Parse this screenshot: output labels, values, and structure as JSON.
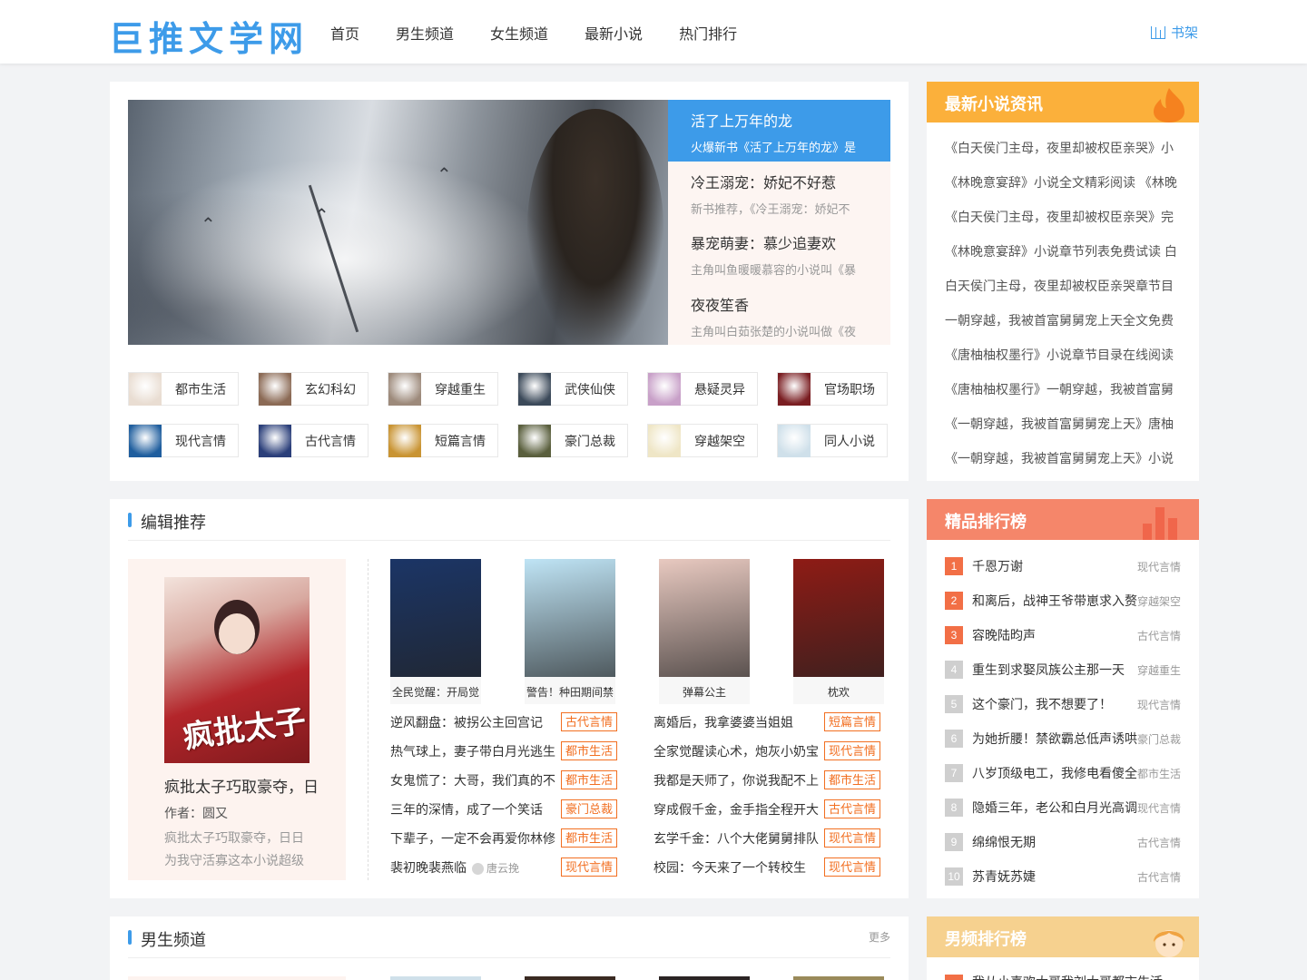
{
  "site": {
    "logo": "巨推文学网",
    "shelf": "书架"
  },
  "nav": [
    "首页",
    "男生频道",
    "女生频道",
    "最新小说",
    "热门排行"
  ],
  "slides": [
    {
      "title": "活了上万年的龙",
      "desc": "火爆新书《活了上万年的龙》是"
    },
    {
      "title": "冷王溺宠：娇妃不好惹",
      "desc": "新书推荐，《冷王溺宠：娇妃不"
    },
    {
      "title": "暴宠萌妻：慕少追妻欢",
      "desc": "主角叫鱼暖暖慕容的小说叫《暴"
    },
    {
      "title": "夜夜笙香",
      "desc": "主角叫白茹张楚的小说叫做《夜"
    }
  ],
  "categories": [
    {
      "label": "都市生活",
      "color": "#e9ddd2"
    },
    {
      "label": "玄幻科幻",
      "color": "#8b6a55"
    },
    {
      "label": "穿越重生",
      "color": "#9d8a7b"
    },
    {
      "label": "武侠仙侠",
      "color": "#3c4a5a"
    },
    {
      "label": "悬疑灵异",
      "color": "#c8a0c8"
    },
    {
      "label": "官场职场",
      "color": "#7a1e22"
    },
    {
      "label": "现代言情",
      "color": "#1f5e9e"
    },
    {
      "label": "古代言情",
      "color": "#2b3f7a"
    },
    {
      "label": "短篇言情",
      "color": "#c99433"
    },
    {
      "label": "豪门总裁",
      "color": "#5a5f3d"
    },
    {
      "label": "穿越架空",
      "color": "#efe6c6"
    },
    {
      "label": "同人小说",
      "color": "#cfe0ea"
    }
  ],
  "news": {
    "title": "最新小说资讯",
    "items": [
      "《白天侯门主母，夜里却被权臣亲哭》小",
      "《林晚意宴辞》小说全文精彩阅读 《林晚",
      "《白天侯门主母，夜里却被权臣亲哭》完",
      "《林晚意宴辞》小说章节列表免费试读 白",
      "白天侯门主母，夜里却被权臣亲哭章节目",
      "一朝穿越，我被首富舅舅宠上天全文免费",
      "《唐柚柚权墨行》小说章节目录在线阅读",
      "《唐柚柚权墨行》一朝穿越，我被首富舅",
      "《一朝穿越，我被首富舅舅宠上天》唐柚",
      "《一朝穿越，我被首富舅舅宠上天》小说"
    ]
  },
  "editor": {
    "title": "编辑推荐",
    "feature": {
      "title": "疯批太子巧取豪夺，日",
      "author": "作者：圆又",
      "desc1": "疯批太子巧取豪夺，日日",
      "desc2": "为我守活寡这本小说超级"
    },
    "books": [
      {
        "title": "全民觉醒：开局觉",
        "color": "#1b3566"
      },
      {
        "title": "警告！种田期间禁",
        "color": "#bfe4f5"
      },
      {
        "title": "弹幕公主",
        "color": "#e8c9c0"
      },
      {
        "title": "枕欢",
        "color": "#8e1b15"
      }
    ],
    "left_rows": [
      {
        "name": "逆风翻盘：被拐公主回宫记",
        "tag": "古代言情"
      },
      {
        "name": "热气球上，妻子带白月光逃生",
        "tag": "都市生活"
      },
      {
        "name": "女鬼慌了：大哥，我们真的不",
        "tag": "都市生活"
      },
      {
        "name": "三年的深情，成了一个笑话",
        "tag": "豪门总裁"
      },
      {
        "name": "下辈子，一定不会再爱你林修",
        "tag": "都市生活"
      },
      {
        "name": "裴初晚裴燕临",
        "author": "唐云挽",
        "tag": "现代言情"
      }
    ],
    "right_rows": [
      {
        "name": "离婚后，我拿婆婆当姐姐",
        "tag": "短篇言情"
      },
      {
        "name": "全家觉醒读心术，炮灰小奶宝",
        "tag": "现代言情"
      },
      {
        "name": "我都是天师了，你说我配不上",
        "tag": "都市生活"
      },
      {
        "name": "穿成假千金，金手指全程开大",
        "tag": "古代言情"
      },
      {
        "name": "玄学千金：八个大佬舅舅排队",
        "tag": "现代言情"
      },
      {
        "name": "校园：今天来了一个转校生",
        "tag": "现代言情"
      }
    ]
  },
  "ranking": {
    "title": "精品排行榜",
    "items": [
      {
        "num": "1",
        "name": "千恩万谢",
        "cat": "现代言情"
      },
      {
        "num": "2",
        "name": "和离后，战神王爷带崽求入赘",
        "cat": "穿越架空"
      },
      {
        "num": "3",
        "name": "容晚陆昀声",
        "cat": "古代言情"
      },
      {
        "num": "4",
        "name": "重生到求娶凤族公主那一天",
        "cat": "穿越重生"
      },
      {
        "num": "5",
        "name": "这个豪门，我不想要了！",
        "cat": "现代言情"
      },
      {
        "num": "6",
        "name": "为她折腰！禁欲霸总低声诱哄",
        "cat": "豪门总裁"
      },
      {
        "num": "7",
        "name": "八岁顶级电工，我修电看傻全",
        "cat": "都市生活"
      },
      {
        "num": "8",
        "name": "隐婚三年，老公和白月光高调",
        "cat": "现代言情"
      },
      {
        "num": "9",
        "name": "绵绵恨无期",
        "cat": "古代言情"
      },
      {
        "num": "10",
        "name": "苏青妩苏婕",
        "cat": "古代言情"
      }
    ]
  },
  "male": {
    "title": "男生频道",
    "more": "更多"
  },
  "male_ranking": {
    "title": "男频排行榜"
  },
  "colors": {
    "accent": "#3d9be9",
    "tag": "#f26f21",
    "news_head": "#fbb03b",
    "rank_head": "#f5866a",
    "male_rank_head": "#f6d18f",
    "rank_top": "#f26f46",
    "rank_other": "#cfcfcf"
  }
}
